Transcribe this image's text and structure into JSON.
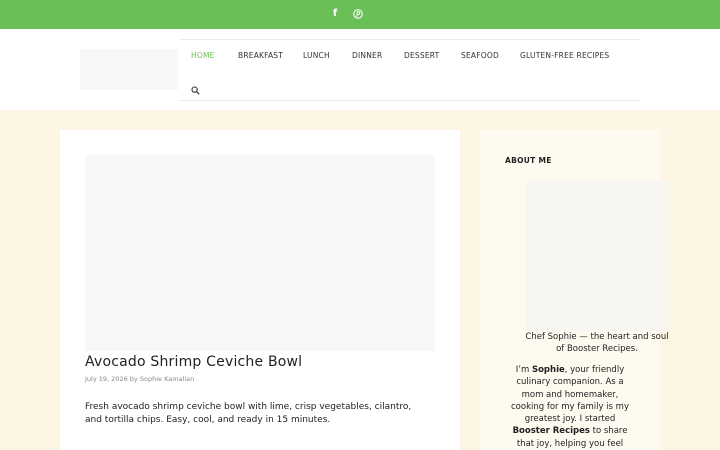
{
  "topbar": {
    "accent": "#6abf56",
    "social": [
      {
        "icon": "facebook-icon",
        "glyph": "f"
      },
      {
        "icon": "pinterest-icon",
        "glyph": "℗"
      }
    ]
  },
  "nav": {
    "items": [
      {
        "label": "HOME",
        "active": true
      },
      {
        "label": "BREAKFAST"
      },
      {
        "label": "LUNCH"
      },
      {
        "label": "DINNER"
      },
      {
        "label": "DESSERT"
      },
      {
        "label": "SEAFOOD"
      },
      {
        "label": "GLUTEN-FREE RECIPES"
      }
    ],
    "search_icon": "search-icon"
  },
  "post": {
    "title": "Avocado Shrimp Ceviche Bowl",
    "date": "July 19, 2026",
    "by": "by",
    "author": "Sophie Kamalian",
    "excerpt": "Fresh avocado shrimp ceviche bowl with lime, crisp vegetables, cilantro, and tortilla chips. Easy, cool, and ready in 15 minutes."
  },
  "sidebar": {
    "widget_title": "ABOUT ME",
    "caption": "Chef Sophie — the heart and soul of Booster Recipes.",
    "about": {
      "p1": "I’m ",
      "name": "Sophie",
      "p2": ", your friendly culinary companion. As a mom and homemaker, cooking for my family is my greatest joy. I started ",
      "brand": "Booster Recipes",
      "p3": " to share that joy, helping you feel"
    }
  }
}
